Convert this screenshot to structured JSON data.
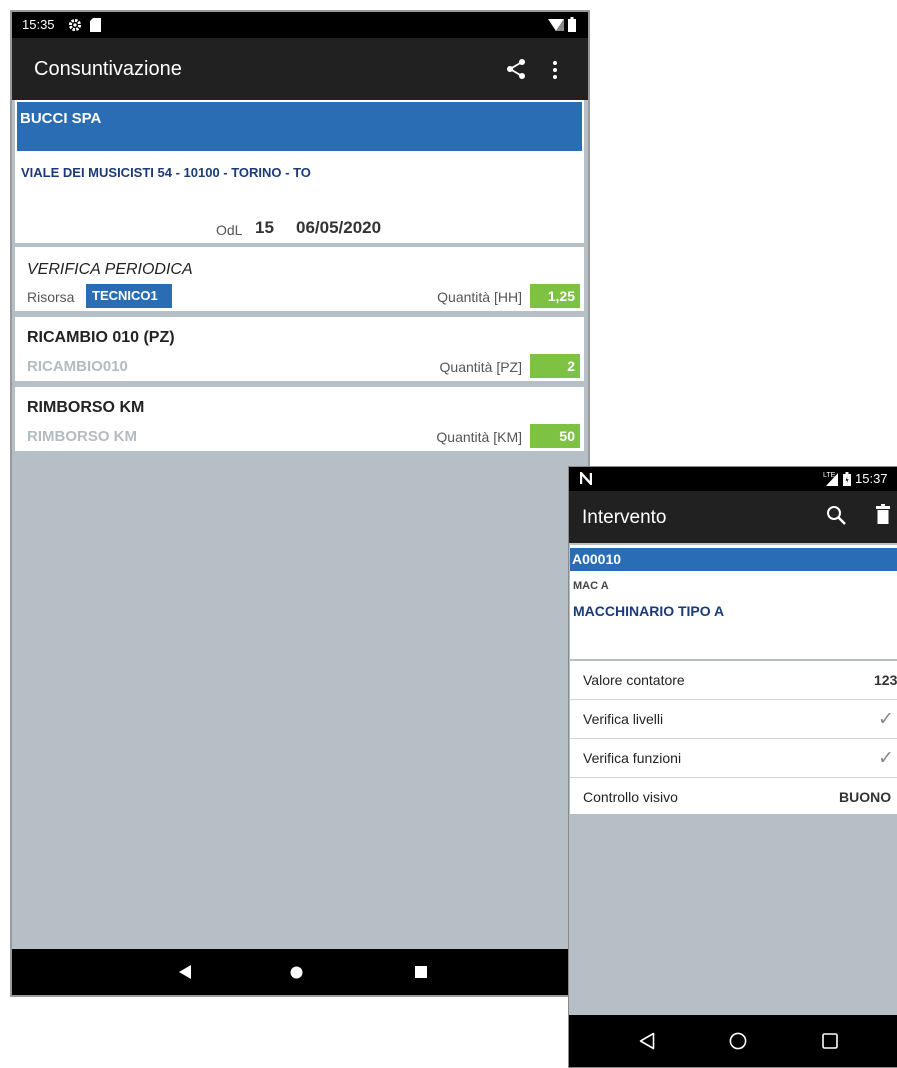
{
  "device_left": {
    "status": {
      "time": "15:35"
    },
    "appbar": {
      "title": "Consuntivazione",
      "share_icon": "share-icon",
      "menu_icon": "more-vert-icon"
    },
    "header": {
      "customer": "BUCCI SPA",
      "address": "VIALE DEI MUSICISTI 54 - 10100 - TORINO - TO",
      "odl_label": "OdL",
      "odl_number": "15",
      "odl_date": "06/05/2020"
    },
    "items": [
      {
        "title": "VERIFICA PERIODICA",
        "resource_label": "Risorsa",
        "resource": "TECNICO1",
        "qty_label": "Quantità [HH]",
        "qty": "1,25"
      },
      {
        "title": "RICAMBIO 010 (PZ)",
        "code": "RICAMBIO010",
        "qty_label": "Quantità [PZ]",
        "qty": "2"
      },
      {
        "title": "RIMBORSO KM",
        "code": "RIMBORSO KM",
        "qty_label": "Quantità [KM]",
        "qty": "50"
      }
    ]
  },
  "device_right": {
    "status": {
      "time": "15:37",
      "network": "LTE"
    },
    "appbar": {
      "title": "Intervento",
      "search_icon": "search-icon",
      "delete_icon": "trash-icon"
    },
    "header": {
      "code": "A00010",
      "short": "MAC A",
      "name": "MACCHINARIO TIPO A"
    },
    "rows": [
      {
        "label": "Valore contatore",
        "value": "123"
      },
      {
        "label": "Verifica livelli",
        "value": "✓"
      },
      {
        "label": "Verifica funzioni",
        "value": "✓"
      },
      {
        "label": "Controllo visivo",
        "value": "BUONO"
      }
    ]
  },
  "colors": {
    "accent_blue": "#2a6db5",
    "navy_text": "#1d3a78",
    "qty_green": "#7dc242",
    "background_gray": "#b6bfc6"
  }
}
